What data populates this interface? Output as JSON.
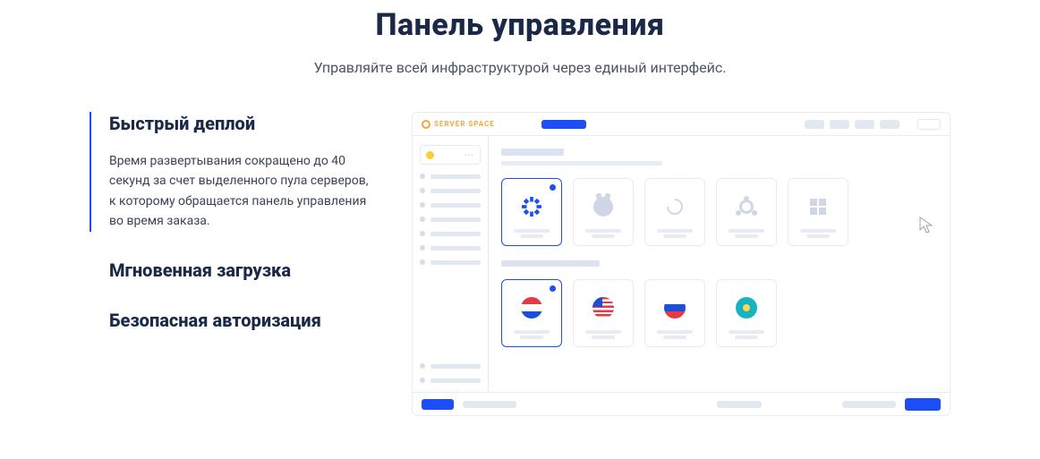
{
  "header": {
    "title": "Панель управления",
    "subtitle": "Управляйте всей инфраструктурой через единый интерфейс."
  },
  "features": [
    {
      "heading": "Быстрый деплой",
      "active": true,
      "body": "Время развертывания сокращено до 40 секунд за счет выделенного пула серверов, к которому обращается панель управления во время заказа."
    },
    {
      "heading": "Мгновенная загрузка",
      "active": false,
      "body": ""
    },
    {
      "heading": "Безопасная авторизация",
      "active": false,
      "body": ""
    }
  ],
  "illustration": {
    "brand_label": "SERVER SPACE",
    "os_cards": [
      {
        "name": "centos",
        "selected": true
      },
      {
        "name": "freebsd",
        "selected": false
      },
      {
        "name": "debian",
        "selected": false
      },
      {
        "name": "ubuntu",
        "selected": false
      },
      {
        "name": "windows",
        "selected": false
      }
    ],
    "region_cards": [
      {
        "name": "netherlands",
        "selected": true,
        "colors": [
          "#e63946",
          "#ffffff",
          "#1d4ed8"
        ]
      },
      {
        "name": "usa",
        "selected": false,
        "colors": []
      },
      {
        "name": "russia",
        "selected": false,
        "colors": [
          "#ffffff",
          "#1d4ed8",
          "#e63946"
        ]
      },
      {
        "name": "kazakhstan",
        "selected": false,
        "colors": [
          "#17b3c1"
        ]
      }
    ]
  }
}
